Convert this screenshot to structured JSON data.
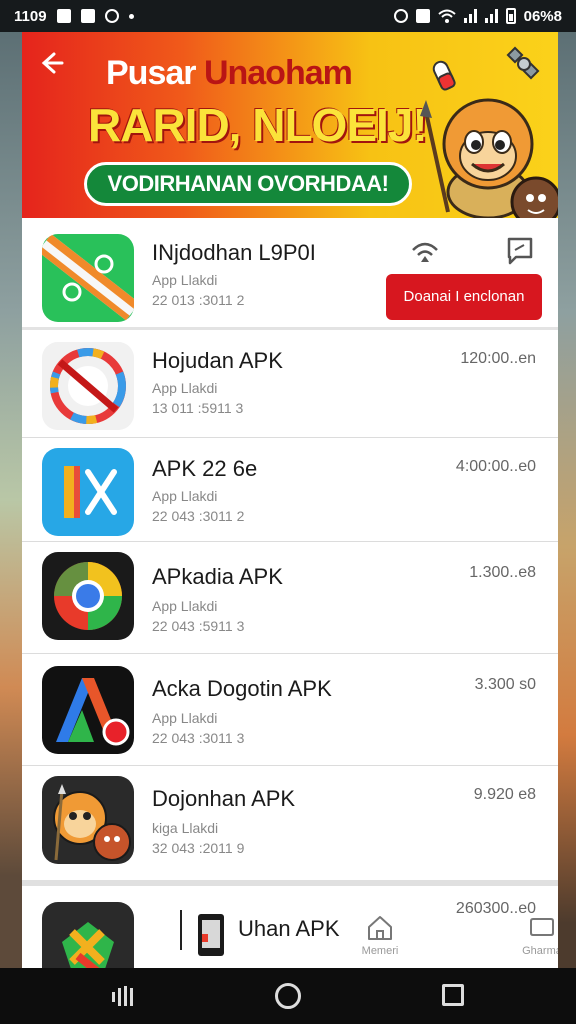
{
  "status_bar": {
    "time": "1109",
    "battery": "06%8"
  },
  "banner": {
    "title_line1_white": "Pusar ",
    "title_line1_red": "Unaoham",
    "title_line2": "RARID, NLOEIJ!",
    "pill_text": "VODIRHANAN OVORHDAA!"
  },
  "featured": {
    "name": "INjdodhan L9P0I",
    "sub1": "App Llakdi",
    "sub2": "22 013 :3011 2",
    "download_label": "Doanai I enclonan"
  },
  "apps": [
    {
      "name": "Hojudan APK",
      "sub1": "App Llakdi",
      "sub2": "13 011 :5911 3",
      "size": "120:00..en"
    },
    {
      "name": "APK 22 6e",
      "sub1": "App Llakdi",
      "sub2": "22 043 :3011 2",
      "size": "4:00:00..e0"
    },
    {
      "name": "APkadia APK",
      "sub1": "App Llakdi",
      "sub2": "22 043 :5911 3",
      "size": "1.300..e8"
    },
    {
      "name": "Acka Dogotin APK",
      "sub1": "App Llakdi",
      "sub2": "22 043 :3011 3",
      "size": "3.300 s0"
    },
    {
      "name": "Dojonhan APK",
      "sub1": "kiga Llakdi",
      "sub2": "32 043 :2011 9",
      "size": "9.920 e8"
    },
    {
      "name": "Uhan APK",
      "sub1": "",
      "sub2": "",
      "size": "260300..e0"
    }
  ],
  "overlay": {
    "item1_label": "Memeri",
    "item2_label": "Gharma"
  },
  "colors": {
    "accent_red": "#d7171f",
    "banner_yellow": "#fbd21a",
    "pill_green": "#14883a"
  },
  "icons": [
    "back-arrow-icon",
    "satellite-icon",
    "signal-icon",
    "message-icon",
    "home-icon",
    "chat-icon"
  ]
}
